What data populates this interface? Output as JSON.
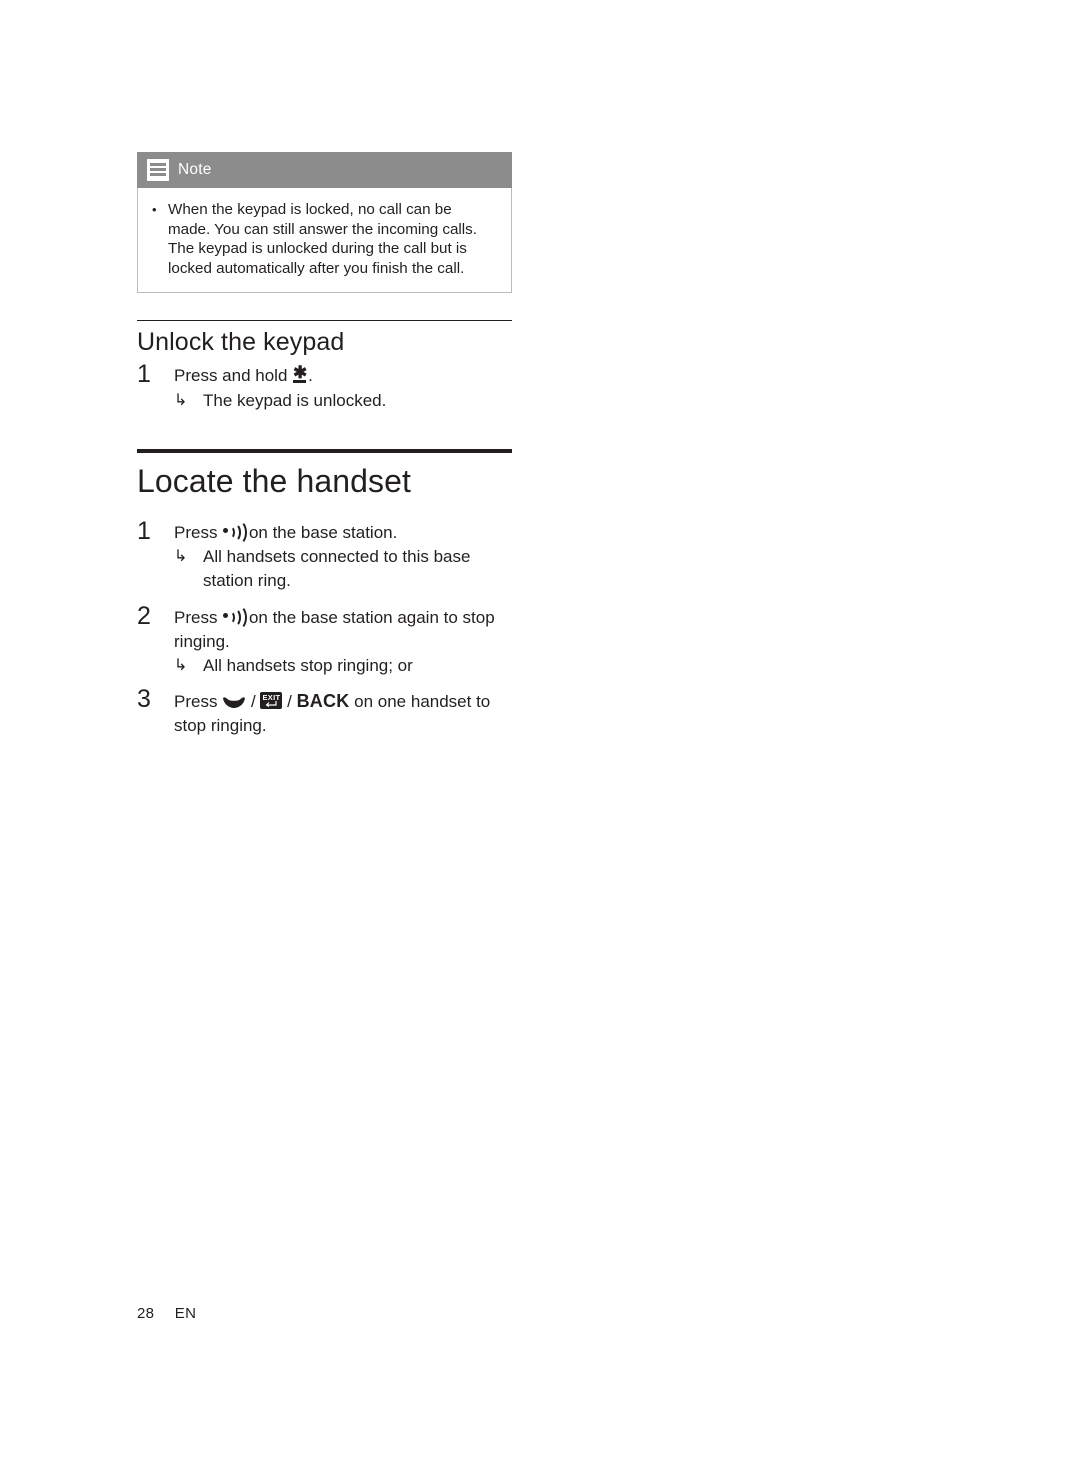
{
  "note": {
    "icon": "note-lines-icon",
    "label": "Note",
    "bullet": "•",
    "text": "When the keypad is locked, no call can be made. You can still answer the incoming calls. The keypad is unlocked during the call but is locked automatically after you finish the call."
  },
  "section_unlock": {
    "heading": "Unlock the keypad",
    "steps": [
      {
        "num": "1",
        "text_before": "Press and hold",
        "icon": "star-key-icon",
        "text_after": ".",
        "result_arrow": "↳",
        "result": "The keypad is unlocked."
      }
    ]
  },
  "section_locate": {
    "heading": "Locate the handset",
    "steps": [
      {
        "num": "1",
        "text_before": "Press",
        "icon": "paging-icon",
        "text_after": "on the base station.",
        "result_arrow": "↳",
        "result": "All handsets connected to this base station ring."
      },
      {
        "num": "2",
        "text_before": "Press",
        "icon": "paging-icon",
        "text_after": "on the base station again to stop ringing.",
        "result_arrow": "↳",
        "result": "All handsets stop ringing; or"
      },
      {
        "num": "3",
        "text_before": "Press",
        "icon_talk": "talk-handset-icon",
        "sep1": "/",
        "icon_exit": "exit-key-icon",
        "exit_label": "EXIT",
        "sep2": "/",
        "back_label": "BACK",
        "text_after": "on one handset to stop ringing."
      }
    ]
  },
  "footer": {
    "page_number": "28",
    "language": "EN"
  }
}
